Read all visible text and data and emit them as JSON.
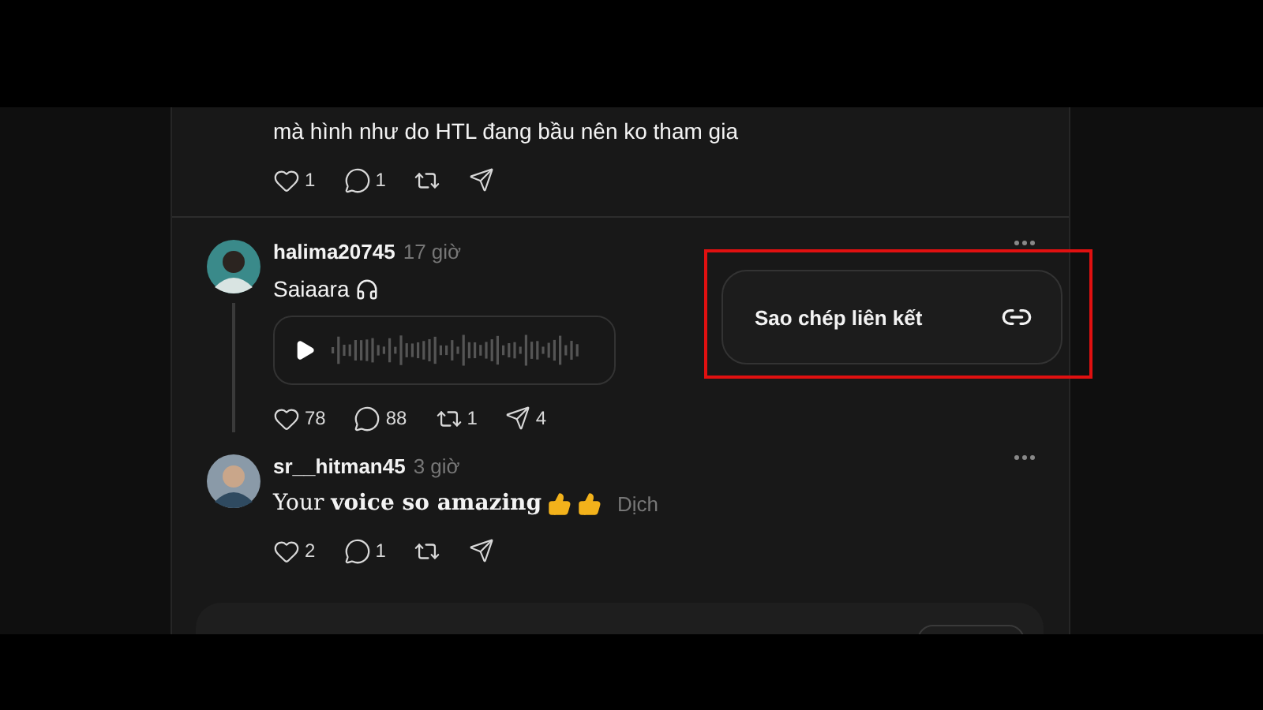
{
  "posts": [
    {
      "kind": "text",
      "body": "mà hình như do HTL đang bầu nên ko tham gia",
      "actions": [
        {
          "kind": "like",
          "count": "1"
        },
        {
          "kind": "comment",
          "count": "1"
        },
        {
          "kind": "repost"
        },
        {
          "kind": "share"
        }
      ]
    },
    {
      "kind": "reply",
      "user": "halima20745",
      "time": "17 giờ",
      "body": "Saiaara",
      "text_icons": [
        {
          "kind": "headphones"
        }
      ],
      "audio": true,
      "thread_line": true,
      "actions": [
        {
          "kind": "like",
          "count": "78"
        },
        {
          "kind": "comment",
          "count": "88"
        },
        {
          "kind": "repost",
          "count": "1"
        },
        {
          "kind": "share",
          "count": "4"
        }
      ]
    },
    {
      "kind": "reply",
      "user": "sr__hitman45",
      "time": "3 giờ",
      "body": "Your **voice so amazing**",
      "text_icons": [
        {
          "kind": "thumbsup"
        },
        {
          "kind": "thumbsup"
        }
      ],
      "translate": "Dịch",
      "audio": false,
      "thread_line": false,
      "actions": [
        {
          "kind": "like",
          "count": "2"
        },
        {
          "kind": "comment",
          "count": "1"
        },
        {
          "kind": "repost"
        },
        {
          "kind": "share"
        }
      ]
    }
  ],
  "menu": {
    "highlighted": true,
    "items": [
      {
        "label": "Sao chép liên kết",
        "kind": "link"
      }
    ]
  }
}
